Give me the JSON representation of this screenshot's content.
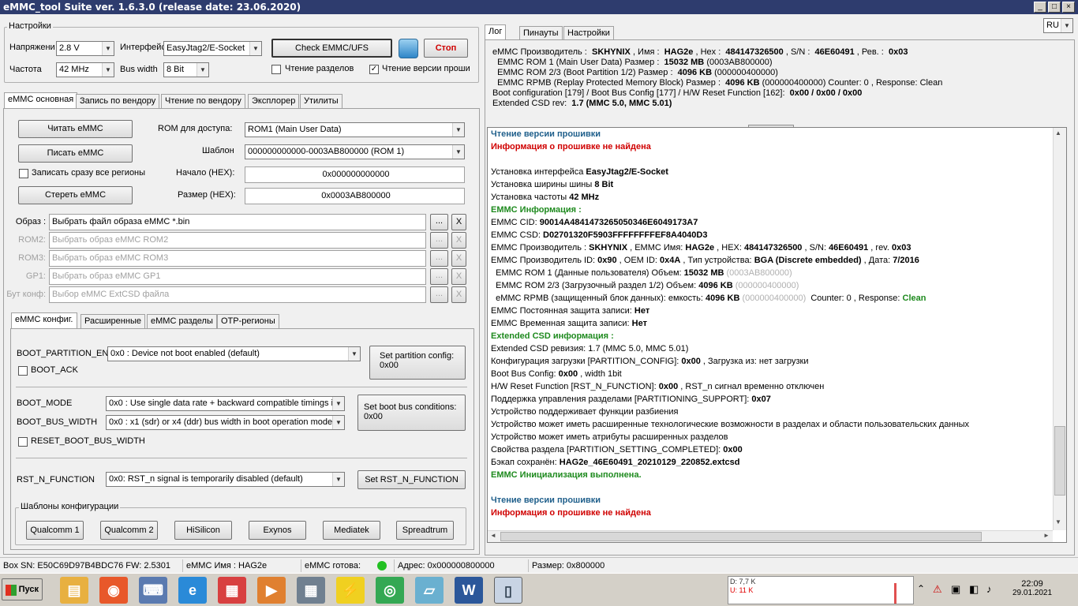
{
  "app": {
    "title": "eMMC_tool Suite  ver. 1.6.3.0 (release date: 23.06.2020)",
    "win_min": "_",
    "win_max": "□",
    "win_close": "×"
  },
  "settings": {
    "group": "Настройки",
    "voltage_label": "Напряжени",
    "voltage": "2.8 V",
    "interface_label": "Интерфейс",
    "interface": "EasyJtag2/E-Socket",
    "freq_label": "Частота",
    "freq": "42 MHz",
    "bus_label": "Bus width",
    "bus": "8 Bit",
    "check_btn": "Check EMMC/UFS",
    "stop_btn": "Стоп",
    "read_parts": "Чтение разделов",
    "read_fw": "Чтение версии проши"
  },
  "tabs": [
    "eMMC основная",
    "Запись по вендору",
    "Чтение по вендору",
    "Эксплорер",
    "Утилиты"
  ],
  "basic": {
    "read_btn": "Читать eMMC",
    "write_btn": "Писать eMMC",
    "write_all": "Записать сразу все регионы",
    "erase_btn": "Стереть eMMC",
    "rom_label": "ROM для доступа:",
    "rom": "ROM1 (Main User Data)",
    "tpl_label": "Шаблон",
    "tpl": "000000000000-0003AB800000 (ROM 1)",
    "start_label": "Начало (HEX):",
    "start": "0x000000000000",
    "size_label": "Размер (HEX):",
    "size": "0x0003AB800000"
  },
  "images": [
    {
      "label": "Образ :",
      "value": "Выбрать файл образа eMMC *.bin",
      "disabled": false
    },
    {
      "label": "ROM2:",
      "value": "Выбрать образ eMMC ROM2",
      "disabled": true
    },
    {
      "label": "ROM3:",
      "value": "Выбрать образ eMMC ROM3",
      "disabled": true
    },
    {
      "label": "GP1:",
      "value": "Выбрать образ eMMC GP1",
      "disabled": true
    },
    {
      "label": "Бут конф:",
      "value": "Выбор eMMC ExtCSD файла",
      "disabled": true
    }
  ],
  "browse": "...",
  "clear": "X",
  "subtabs": [
    "eMMC конфиг.",
    "Расширенные",
    "eMMC разделы",
    "OTP-регионы"
  ],
  "config": {
    "boot_part_label": "BOOT_PARTITION_EN",
    "boot_part": "0x0 : Device not boot enabled (default)",
    "set_part_btn": "Set partition config:",
    "set_part_val": "0x00",
    "boot_ack": "BOOT_ACK",
    "boot_mode_label": "BOOT_MODE",
    "boot_mode": "0x0 : Use single data rate + backward compatible timings in",
    "bus_width_label": "BOOT_BUS_WIDTH",
    "bus_width": "0x0 : x1 (sdr) or x4 (ddr) bus width in boot operation mode",
    "set_bus_btn": "Set boot bus conditions:",
    "set_bus_val": "0x00",
    "reset_bus": "RESET_BOOT_BUS_WIDTH",
    "rst_label": "RST_N_FUNCTION",
    "rst": "0x0: RST_n signal is temporarily disabled (default)",
    "set_rst_btn": "Set RST_N_FUNCTION",
    "templates": "Шаблоны конфигурации"
  },
  "template_btns": [
    "Qualcomm 1",
    "Qualcomm 2",
    "HiSilicon",
    "Exynos",
    "Mediatek",
    "Spreadtrum"
  ],
  "right_tabs": [
    "Лог",
    "Пинауты",
    "Настройки"
  ],
  "lang": "RU",
  "info": [
    [
      {
        "t": "eMMC Производитель :  "
      },
      {
        "t": "SKHYNIX",
        "c": "b"
      },
      {
        "t": " , Имя :  "
      },
      {
        "t": "HAG2e",
        "c": "b"
      },
      {
        "t": " , Hex :  "
      },
      {
        "t": "484147326500",
        "c": "b"
      },
      {
        "t": " , S/N :  "
      },
      {
        "t": "46E60491",
        "c": "b"
      },
      {
        "t": " , Рев. :  "
      },
      {
        "t": "0x03",
        "c": "b"
      }
    ],
    [
      {
        "t": "  EMMC ROM 1 (Main User Data) Размер :  "
      },
      {
        "t": "15032 MB",
        "c": "b"
      },
      {
        "t": " (0003AB800000)"
      }
    ],
    [
      {
        "t": "  EMMC ROM 2/3 (Boot Partition 1/2) Размер :  "
      },
      {
        "t": "4096 KB",
        "c": "b"
      },
      {
        "t": " (000000400000)"
      }
    ],
    [
      {
        "t": "  EMMC RPMB (Replay Protected Memory Block) Размер :  "
      },
      {
        "t": "4096 KB",
        "c": "b"
      },
      {
        "t": " (000000400000) Counter: 0 , Response: Clean"
      }
    ],
    [
      {
        "t": "Boot configuration [179] / Boot Bus Config [177] / H/W Reset Function [162]:  "
      },
      {
        "t": "0x00 / 0x00 / 0x00",
        "c": "b"
      }
    ],
    [
      {
        "t": "Extended CSD rev:  "
      },
      {
        "t": "1.7 (MMC 5.0, MMC 5.01)",
        "c": "b"
      }
    ]
  ],
  "log": [
    [
      {
        "t": "Чтение версии прошивки",
        "c": "blue"
      }
    ],
    [
      {
        "t": "Информация о прошивке не найдена",
        "c": "red"
      }
    ],
    [],
    [
      {
        "t": "Установка интерфейса "
      },
      {
        "t": "EasyJtag2/E-Socket",
        "c": "b"
      }
    ],
    [
      {
        "t": "Установка ширины шины "
      },
      {
        "t": "8 Bit",
        "c": "b"
      }
    ],
    [
      {
        "t": "Установка частоты "
      },
      {
        "t": "42 MHz",
        "c": "b"
      }
    ],
    [
      {
        "t": "EMMC Информация :",
        "c": "green"
      }
    ],
    [
      {
        "t": "EMMC CID: "
      },
      {
        "t": "90014A4841473265050346E6049173A7",
        "c": "b"
      }
    ],
    [
      {
        "t": "EMMC CSD: "
      },
      {
        "t": "D02701320F5903FFFFFFFFEF8A4040D3",
        "c": "b"
      }
    ],
    [
      {
        "t": "EMMC Производитель : "
      },
      {
        "t": "SKHYNIX",
        "c": "b"
      },
      {
        "t": " , EMMC Имя: "
      },
      {
        "t": "HAG2e",
        "c": "b"
      },
      {
        "t": " , HEX: "
      },
      {
        "t": "484147326500",
        "c": "b"
      },
      {
        "t": " , S/N: "
      },
      {
        "t": "46E60491",
        "c": "b"
      },
      {
        "t": " , rev. "
      },
      {
        "t": "0x03",
        "c": "b"
      }
    ],
    [
      {
        "t": "EMMC Производитель ID: "
      },
      {
        "t": "0x90",
        "c": "b"
      },
      {
        "t": " , OEM ID: "
      },
      {
        "t": "0x4A",
        "c": "b"
      },
      {
        "t": " , Тип устройства: "
      },
      {
        "t": "BGA (Discrete embedded)",
        "c": "b"
      },
      {
        "t": " , Дата: "
      },
      {
        "t": "7/2016",
        "c": "b"
      }
    ],
    [
      {
        "t": "  EMMC ROM 1 (Данные пользователя) Объем: "
      },
      {
        "t": "15032 MB",
        "c": "b"
      },
      {
        "t": " (0003AB800000)",
        "c": "grey"
      }
    ],
    [
      {
        "t": "  EMMC ROM 2/3 (Загрузочный раздел 1/2) Объем: "
      },
      {
        "t": "4096 KB",
        "c": "b"
      },
      {
        "t": " (000000400000)",
        "c": "grey"
      }
    ],
    [
      {
        "t": "  eMMC RPMB (защищенный блок данных): емкость: "
      },
      {
        "t": "4096 KB",
        "c": "b"
      },
      {
        "t": " (000000400000)",
        "c": "grey"
      },
      {
        "t": "  Counter: 0 , Response: "
      },
      {
        "t": "Clean",
        "c": "green"
      }
    ],
    [
      {
        "t": "EMMC Постоянная защита записи: "
      },
      {
        "t": "Нет",
        "c": "b"
      }
    ],
    [
      {
        "t": "EMMC Временная защита записи: "
      },
      {
        "t": "Нет",
        "c": "b"
      }
    ],
    [
      {
        "t": "Extended CSD информация :",
        "c": "green"
      }
    ],
    [
      {
        "t": "Extended CSD ревизия: 1.7 (MMC 5.0, MMC 5.01)"
      }
    ],
    [
      {
        "t": "Конфигурация загрузки [PARTITION_CONFIG]: "
      },
      {
        "t": "0x00",
        "c": "b"
      },
      {
        "t": " , Загрузка из: нет загрузки"
      }
    ],
    [
      {
        "t": "Boot Bus Config: "
      },
      {
        "t": "0x00",
        "c": "b"
      },
      {
        "t": " , width 1bit"
      }
    ],
    [
      {
        "t": "H/W Reset Function [RST_N_FUNCTION]: "
      },
      {
        "t": "0x00",
        "c": "b"
      },
      {
        "t": " , RST_n сигнал временно отключен"
      }
    ],
    [
      {
        "t": "Поддержка управления разделами [PARTITIONING_SUPPORT]: "
      },
      {
        "t": "0x07",
        "c": "b"
      }
    ],
    [
      {
        "t": "Устройство поддерживает функции разбиения"
      }
    ],
    [
      {
        "t": "Устройство может иметь расширенные технологические возможности в разделах и области пользовательских данных"
      }
    ],
    [
      {
        "t": "Устройство может иметь атрибуты расширенных разделов"
      }
    ],
    [
      {
        "t": "Свойства раздела [PARTITION_SETTING_COMPLETED]: "
      },
      {
        "t": "0x00",
        "c": "b"
      }
    ],
    [
      {
        "t": "Бэкап сохранён: "
      },
      {
        "t": "HAG2e_46E60491_20210129_220852.extcsd",
        "c": "b"
      }
    ],
    [
      {
        "t": "EMMC Инициализация выполнена.",
        "c": "green"
      }
    ],
    [],
    [
      {
        "t": "Чтение версии прошивки",
        "c": "blue"
      }
    ],
    [
      {
        "t": "Информация о прошивке не найдена",
        "c": "red"
      }
    ]
  ],
  "status": {
    "box": "Box SN:  E50C69D97B4BDC76  FW:  2.5301",
    "name": "eMMC Имя : HAG2e",
    "ready": "eMMC готова:",
    "addr": "Адрес: 0x000000800000",
    "size": "Размер: 0x800000",
    "ready_color": "#22c022"
  },
  "taskbar": {
    "start": "Пуск",
    "icons": [
      "explorer-icon",
      "firefox-icon",
      "network-icon",
      "ie-icon",
      "calendar-icon",
      "media-icon",
      "calculator-icon",
      "lightning-icon",
      "chrome-icon",
      "notebook-icon",
      "word-icon",
      "emmc-tool-icon"
    ],
    "net_d": "D: 7,7 K",
    "net_u": "U: 11 K",
    "time": "22:09",
    "date": "29.01.2021"
  }
}
